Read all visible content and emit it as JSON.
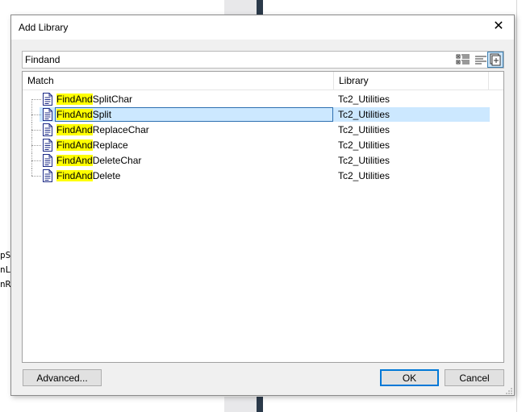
{
  "background": {
    "fragments": [
      "pS",
      "nL",
      "nR"
    ]
  },
  "dialog": {
    "title": "Add Library",
    "close_glyph": "✕",
    "search": {
      "value": "Findand",
      "placeholder": ""
    },
    "toolbar_icons": [
      "category-view-icon",
      "list-view-icon",
      "detail-view-icon"
    ],
    "columns": {
      "match": "Match",
      "library": "Library"
    },
    "rows": [
      {
        "highlight": "FindAnd",
        "rest": "SplitChar",
        "library": "Tc2_Utilities",
        "selected": false
      },
      {
        "highlight": "FindAnd",
        "rest": "Split",
        "library": "Tc2_Utilities",
        "selected": true
      },
      {
        "highlight": "FindAnd",
        "rest": "ReplaceChar",
        "library": "Tc2_Utilities",
        "selected": false
      },
      {
        "highlight": "FindAnd",
        "rest": "Replace",
        "library": "Tc2_Utilities",
        "selected": false
      },
      {
        "highlight": "FindAnd",
        "rest": "DeleteChar",
        "library": "Tc2_Utilities",
        "selected": false
      },
      {
        "highlight": "FindAnd",
        "rest": "Delete",
        "library": "Tc2_Utilities",
        "selected": false
      }
    ],
    "buttons": {
      "advanced": "Advanced...",
      "ok": "OK",
      "cancel": "Cancel"
    },
    "colors": {
      "highlight": "#ffff00",
      "selection": "#cce8ff",
      "accent": "#0078d7"
    }
  }
}
